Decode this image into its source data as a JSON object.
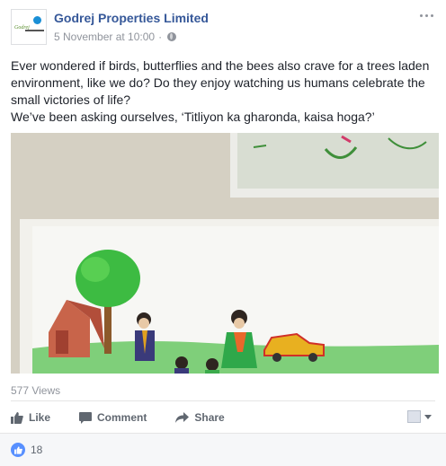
{
  "post": {
    "page_name": "Godrej Properties Limited",
    "timestamp": "5 November at 10:00",
    "separator": "·",
    "avatar_brand": "Godrej",
    "text_para1": "Ever wondered if birds, butterflies and the bees also crave for a trees laden environment, like we do? Do they enjoy watching us humans celebrate the small victories of life?",
    "text_para2": "We’ve been asking ourselves, ‘Titliyon ka gharonda, kaisa hoga?’",
    "views": "577 Views"
  },
  "actions": {
    "like_label": "Like",
    "comment_label": "Comment",
    "share_label": "Share"
  },
  "reactions": {
    "count": "18"
  },
  "colors": {
    "link_blue": "#365899",
    "like_blue": "#5890ff",
    "meta_gray": "#90949c",
    "action_gray": "#606770"
  },
  "icons": {
    "globe": "globe-icon",
    "more": "more-dots-icon",
    "like": "thumbs-up-icon",
    "comment": "comment-bubble-icon",
    "share": "share-arrow-icon"
  }
}
